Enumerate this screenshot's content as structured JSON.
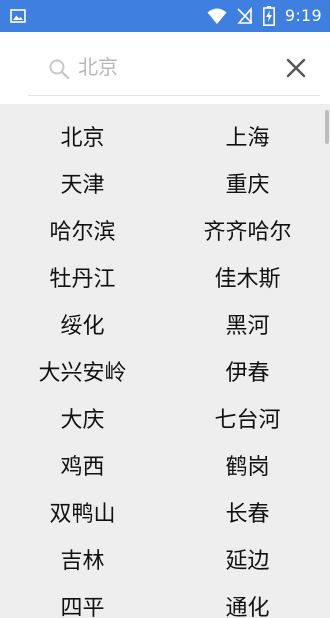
{
  "status_bar": {
    "time": "9:19",
    "icons": [
      "image-icon",
      "wifi-icon",
      "signal-off-icon",
      "battery-charging-icon"
    ],
    "background": "#3f7fe0"
  },
  "search": {
    "value": "",
    "placeholder": "北京",
    "icon": "search-icon",
    "clear_icon": "close-icon"
  },
  "cities": [
    [
      "北京",
      "上海"
    ],
    [
      "天津",
      "重庆"
    ],
    [
      "哈尔滨",
      "齐齐哈尔"
    ],
    [
      "牡丹江",
      "佳木斯"
    ],
    [
      "绥化",
      "黑河"
    ],
    [
      "大兴安岭",
      "伊春"
    ],
    [
      "大庆",
      "七台河"
    ],
    [
      "鸡西",
      "鹤岗"
    ],
    [
      "双鸭山",
      "长春"
    ],
    [
      "吉林",
      "延边"
    ],
    [
      "四平",
      "通化"
    ]
  ],
  "colors": {
    "list_background": "#eeeeee",
    "text": "#111111"
  }
}
